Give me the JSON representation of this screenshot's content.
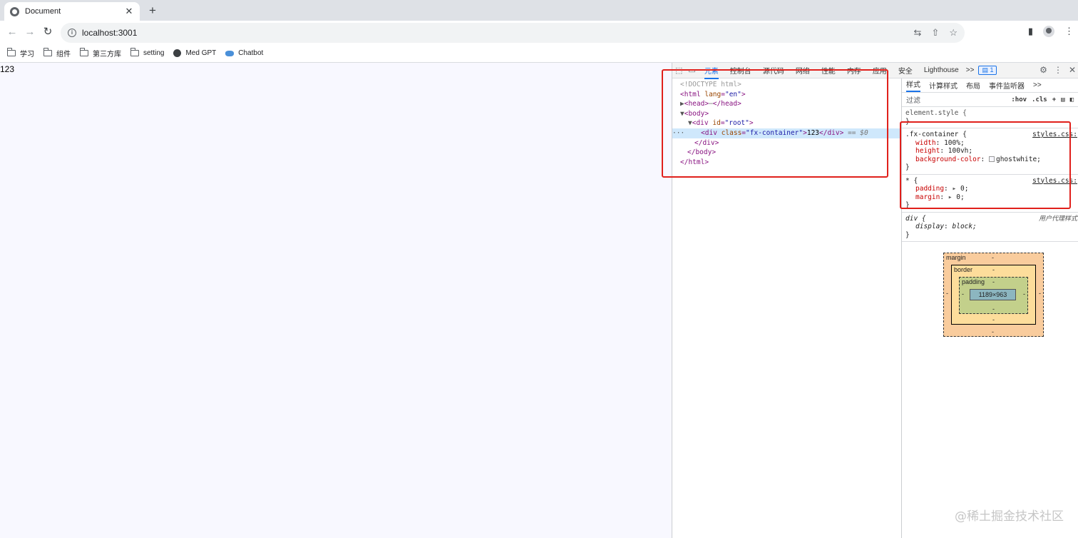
{
  "browser": {
    "tab": {
      "title": "Document"
    },
    "new_tab_label": "+",
    "url": "localhost:3001",
    "bookmarks": [
      {
        "label": "学习",
        "icon": "folder-icon"
      },
      {
        "label": "组件",
        "icon": "folder-icon"
      },
      {
        "label": "第三方库",
        "icon": "folder-icon"
      },
      {
        "label": "setting",
        "icon": "folder-icon"
      },
      {
        "label": "Med GPT",
        "icon": "globe-icon"
      },
      {
        "label": "Chatbot",
        "icon": "bot-icon"
      }
    ]
  },
  "page": {
    "text": "123",
    "background": "#f8f8ff"
  },
  "devtools": {
    "tabs": [
      "元素",
      "控制台",
      "源代码",
      "网络",
      "性能",
      "内存",
      "应用",
      "安全",
      "Lighthouse"
    ],
    "more_tabs": ">>",
    "issues_count": "1",
    "elements": {
      "doctype": "<!DOCTYPE html>",
      "html_open": "<html",
      "html_attr": "lang",
      "html_val": "\"en\"",
      "head": "<head>",
      "head_close": "</head>",
      "body_open": "<body>",
      "div_root_open": "<div",
      "root_attr": "id",
      "root_val": "\"root\"",
      "div_open": "<div",
      "div_attr": "class",
      "div_val": "\"fx-container\"",
      "div_text": "123",
      "div_close": "</div>",
      "selected_marker": "== $0",
      "root_close": "</div>",
      "body_close": "</body>",
      "html_close": "</html>"
    },
    "styles_tabs": [
      "样式",
      "计算样式",
      "布局",
      "事件监听器"
    ],
    "styles_more": ">>",
    "filter_placeholder": "过滤",
    "filter_hov": ":hov",
    "filter_cls": ".cls",
    "rules": {
      "element_style": "element.style {",
      "close": "}",
      "fx": {
        "selector": ".fx-container {",
        "source": "styles.css:",
        "props": [
          {
            "name": "width",
            "value": "100%;"
          },
          {
            "name": "height",
            "value": "100vh;"
          },
          {
            "name": "background-color",
            "value": "ghostwhite;"
          }
        ]
      },
      "star": {
        "selector": "* {",
        "source": "styles.css:",
        "props": [
          {
            "name": "padding",
            "value": "0;"
          },
          {
            "name": "margin",
            "value": "0;"
          }
        ]
      },
      "div": {
        "selector": "div {",
        "source": "用户代理样式",
        "props": [
          {
            "name": "display",
            "value": "block;"
          }
        ]
      }
    },
    "box_model": {
      "margin": "margin",
      "border": "border",
      "padding": "padding",
      "content": "1189×963",
      "dash": "-"
    }
  },
  "watermark": "@稀土掘金技术社区"
}
